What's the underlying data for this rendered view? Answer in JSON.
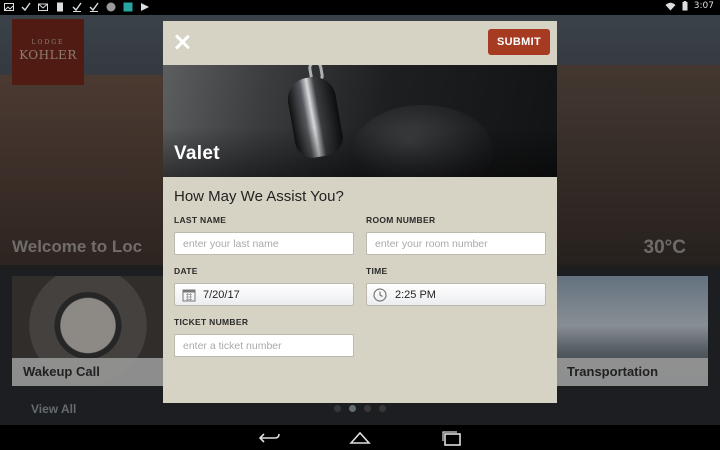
{
  "status_bar": {
    "time": "3:07",
    "icons": [
      "image-icon",
      "check-icon",
      "mail-icon",
      "doc-icon",
      "check-icon",
      "check-icon",
      "app-icon",
      "app-icon",
      "play-icon"
    ],
    "right_icons": [
      "wifi-icon",
      "battery-icon"
    ]
  },
  "background": {
    "logo_text_small": "LODGE",
    "logo_text": "KOHLER",
    "welcome_text": "Welcome to Loc",
    "temperature": "30°C",
    "tiles": [
      {
        "label": "Wakeup Call"
      },
      {
        "label": "Transportation"
      }
    ],
    "view_all": "View All",
    "page_dots": 4,
    "active_dot": 1
  },
  "modal": {
    "close_icon": "close-icon",
    "submit_label": "SUBMIT",
    "service_title": "Valet",
    "form_heading": "How May We Assist You?",
    "fields": {
      "last_name": {
        "label": "LAST NAME",
        "placeholder": "enter your last name",
        "value": ""
      },
      "room_number": {
        "label": "ROOM NUMBER",
        "placeholder": "enter your room number",
        "value": ""
      },
      "date": {
        "label": "DATE",
        "value": "7/20/17",
        "icon": "calendar-icon"
      },
      "time": {
        "label": "TIME",
        "value": "2:25 PM",
        "icon": "clock-icon"
      },
      "ticket_number": {
        "label": "TICKET NUMBER",
        "placeholder": "enter a ticket number",
        "value": ""
      }
    },
    "colors": {
      "panel": "#d6d2c4",
      "submit": "#a63b22"
    }
  },
  "nav_bar": {
    "buttons": [
      "back-icon",
      "home-icon",
      "recents-icon"
    ]
  }
}
